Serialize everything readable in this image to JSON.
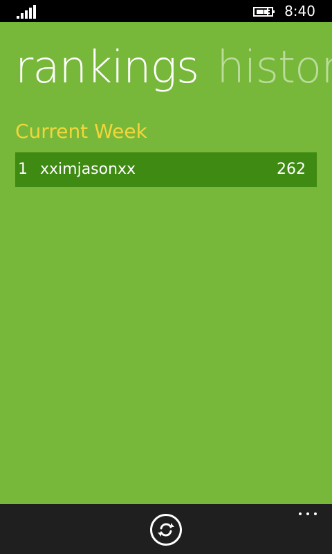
{
  "status_bar": {
    "time": "8:40",
    "signal_icon": "signal-strength-icon",
    "battery_icon": "battery-charging-icon"
  },
  "pivot": {
    "items": [
      {
        "label": "rankings",
        "active": true
      },
      {
        "label": "histor",
        "active": false
      }
    ]
  },
  "current_week": {
    "title": "Current Week",
    "rows": [
      {
        "rank": "1",
        "name": "xximjasonxx",
        "score": "262"
      }
    ]
  },
  "app_bar": {
    "refresh_icon": "refresh-icon",
    "more_icon": "more-dots-icon"
  },
  "colors": {
    "background": "#77b83a",
    "row": "#3f8a12",
    "accent": "#f2d63b",
    "app_bar": "#1f1f1f"
  }
}
